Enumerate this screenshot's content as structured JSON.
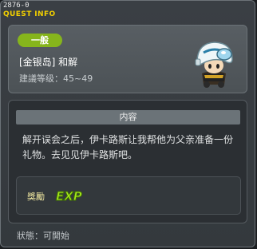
{
  "header": {
    "quest_id": "2876-0",
    "title": "QUEST INFO"
  },
  "quest": {
    "badge": "一般",
    "name": "[金银岛] 和解",
    "level": "建議等级：45~49"
  },
  "content": {
    "heading": "内容",
    "description": "解开误会之后，伊卡路斯让我帮他为父亲准备一份礼物。去见见伊卡路斯吧。"
  },
  "reward": {
    "label": "獎勵",
    "item": "EXP"
  },
  "status": "狀態：可開始",
  "colors": {
    "badge": "#86b51c",
    "title": "#f3d000",
    "exp": "#a6e81c"
  }
}
